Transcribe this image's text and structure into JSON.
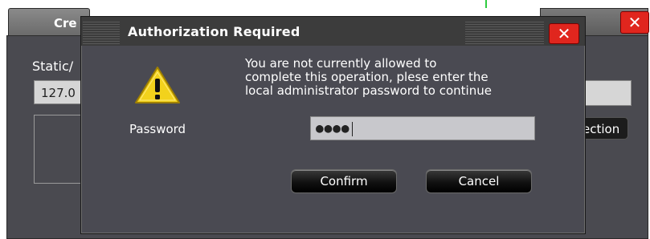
{
  "background_window": {
    "tab_label": "Cre",
    "close_label": "✕",
    "static_label": "Static/",
    "ip_value": "127.0",
    "right_button_label": "ection"
  },
  "dialog": {
    "title": "Authorization Required",
    "close_label": "✕",
    "icon": "warning-icon",
    "message": "You are not currently allowed to\ncomplete this operation, plese enter the\nlocal administrator password to continue",
    "password_label": "Password",
    "password_value": "●●●●",
    "confirm_label": "Confirm",
    "cancel_label": "Cancel"
  },
  "colors": {
    "close_red": "#e0261e",
    "dialog_bg": "#4a4a52",
    "warning_yellow": "#f2d21c"
  }
}
